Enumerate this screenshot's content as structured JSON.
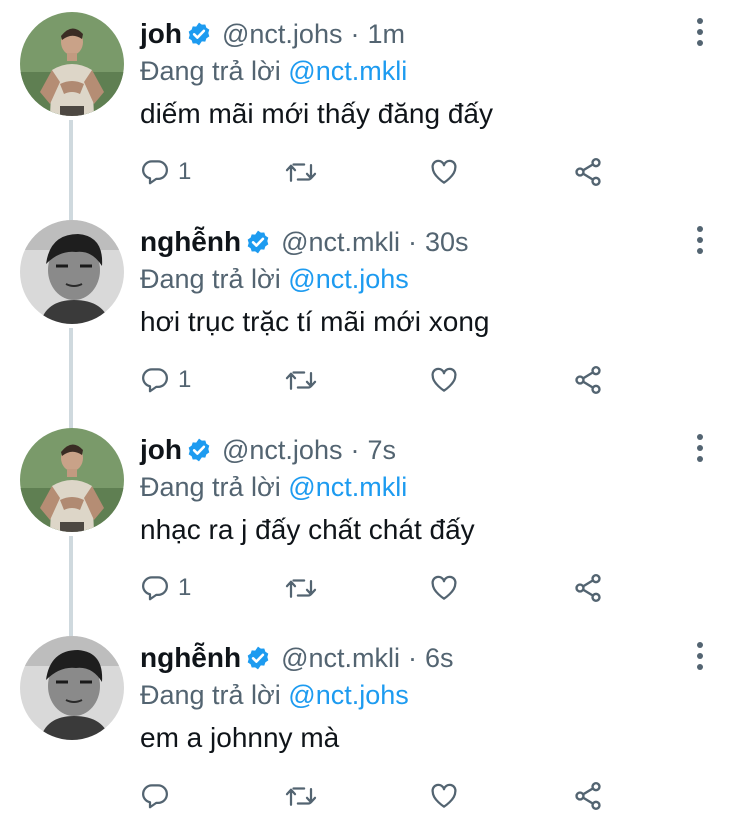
{
  "colors": {
    "accent": "#1d9bf0",
    "text_primary": "#0f1419",
    "text_secondary": "#536471",
    "thread_line": "#cfd9de"
  },
  "reply_prefix": "Đang trả lời",
  "tweets": [
    {
      "name": "joh",
      "handle": "@nct.johs",
      "separator": "·",
      "time": "1m",
      "replying_to": "@nct.mkli",
      "text": "diếm mãi mới thấy đăng đấy",
      "reply_count": "1",
      "avatar": "avatar-photo-joh",
      "verified_icon": "verified-badge-icon"
    },
    {
      "name": "nghễnh",
      "handle": "@nct.mkli",
      "separator": "·",
      "time": "30s",
      "replying_to": "@nct.johs",
      "text": "hơi trục trặc tí mãi mới xong",
      "reply_count": "1",
      "avatar": "avatar-photo-nghenh",
      "verified_icon": "verified-badge-icon"
    },
    {
      "name": "joh",
      "handle": "@nct.johs",
      "separator": "·",
      "time": "7s",
      "replying_to": "@nct.mkli",
      "text": "nhạc ra j đấy chất chát đấy",
      "reply_count": "1",
      "avatar": "avatar-photo-joh",
      "verified_icon": "verified-badge-icon"
    },
    {
      "name": "nghễnh",
      "handle": "@nct.mkli",
      "separator": "·",
      "time": "6s",
      "replying_to": "@nct.johs",
      "text": "em a johnny mà",
      "reply_count": "",
      "avatar": "avatar-photo-nghenh",
      "verified_icon": "verified-badge-icon"
    }
  ],
  "action_icons": [
    "reply-icon",
    "retweet-icon",
    "like-icon",
    "share-icon"
  ]
}
